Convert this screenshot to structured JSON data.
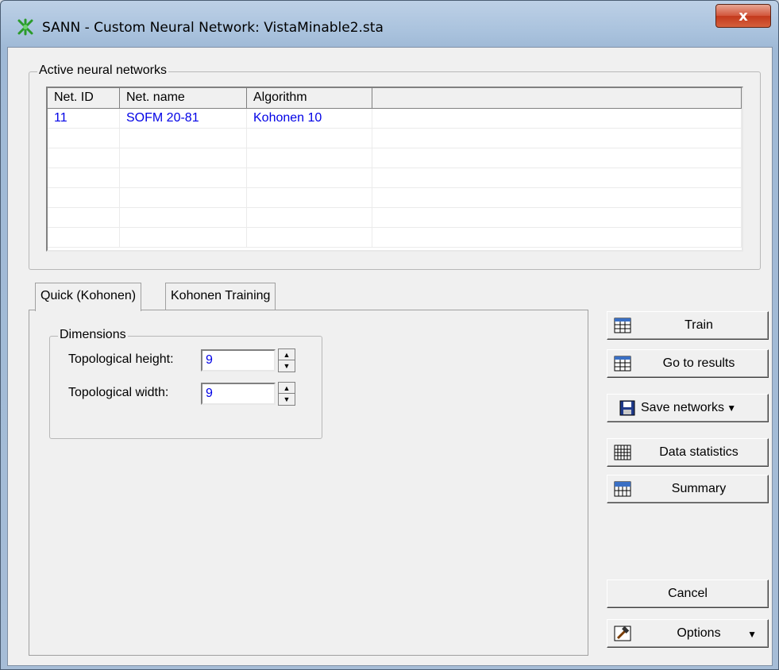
{
  "window": {
    "title": "SANN - Custom Neural Network: VistaMinable2.sta",
    "close_label": "x",
    "icon": "sann-network-icon"
  },
  "active_networks": {
    "group_title": "Active neural networks",
    "columns": [
      "Net. ID",
      "Net. name",
      "Algorithm",
      ""
    ],
    "rows": [
      [
        "11",
        "SOFM 20-81",
        "Kohonen 10",
        ""
      ]
    ]
  },
  "tabs": [
    {
      "label": "Quick (Kohonen)",
      "active": true
    },
    {
      "label": "Kohonen Training",
      "active": false
    }
  ],
  "dimensions": {
    "group_title": "Dimensions",
    "height_label": "Topological height:",
    "height_value": "9",
    "width_label": "Topological width:",
    "width_value": "9"
  },
  "buttons": {
    "train": "Train",
    "go_to_results": "Go to results",
    "save_networks": "Save networks",
    "data_statistics": "Data statistics",
    "summary": "Summary",
    "cancel": "Cancel",
    "options": "Options"
  },
  "icons": {
    "train": "spreadsheet-icon",
    "results": "spreadsheet-icon",
    "save": "floppy-disk-icon",
    "stats": "grid-table-icon",
    "summary": "summary-table-icon",
    "options": "options-hammer-icon"
  }
}
